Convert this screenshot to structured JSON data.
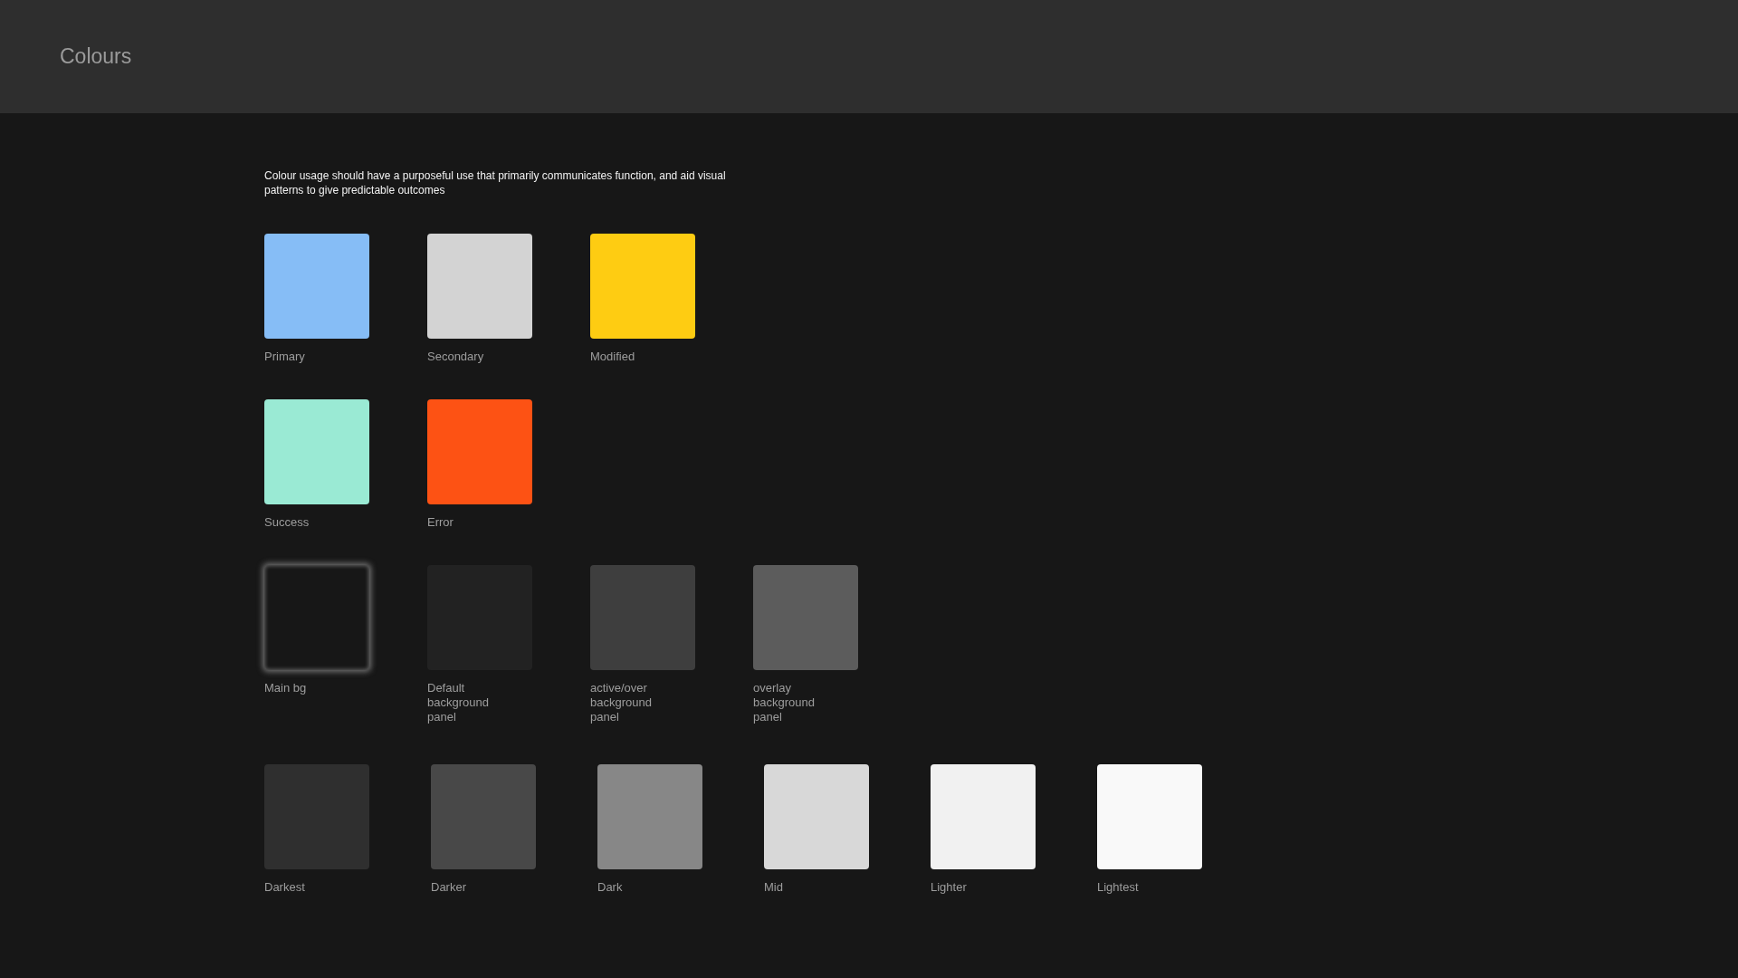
{
  "header": {
    "title": "Colours"
  },
  "description": "Colour usage should have a purposeful use that primarily communicates function, and aid visual patterns to give predictable outcomes",
  "swatch_groups": [
    {
      "swatches": [
        {
          "label": "Primary",
          "color": "#86bdf6",
          "glow": false
        },
        {
          "label": "Secondary",
          "color": "#d3d3d3",
          "glow": false
        },
        {
          "label": "Modified",
          "color": "#fecc12",
          "glow": false
        }
      ]
    },
    {
      "swatches": [
        {
          "label": "Success",
          "color": "#9aead4",
          "glow": false
        },
        {
          "label": "Error",
          "color": "#fd5214",
          "glow": false
        }
      ]
    },
    {
      "swatches": [
        {
          "label": "Main bg",
          "color": "#171717",
          "glow": true
        },
        {
          "label": "Default background panel",
          "color": "#222222",
          "glow": false
        },
        {
          "label": "active/over background panel",
          "color": "#3e3e3e",
          "glow": false
        },
        {
          "label": "overlay background panel",
          "color": "#5c5c5c",
          "glow": false
        }
      ]
    },
    {
      "swatches": [
        {
          "label": "Darkest",
          "color": "#2f2f2f",
          "glow": false
        },
        {
          "label": "Darker",
          "color": "#484848",
          "glow": false
        },
        {
          "label": "Dark",
          "color": "#878787",
          "glow": false
        },
        {
          "label": "Mid",
          "color": "#d8d8d8",
          "glow": false
        },
        {
          "label": "Lighter",
          "color": "#f1f1f1",
          "glow": false
        },
        {
          "label": "Lightest",
          "color": "#f9f9f9",
          "glow": false
        }
      ]
    }
  ]
}
